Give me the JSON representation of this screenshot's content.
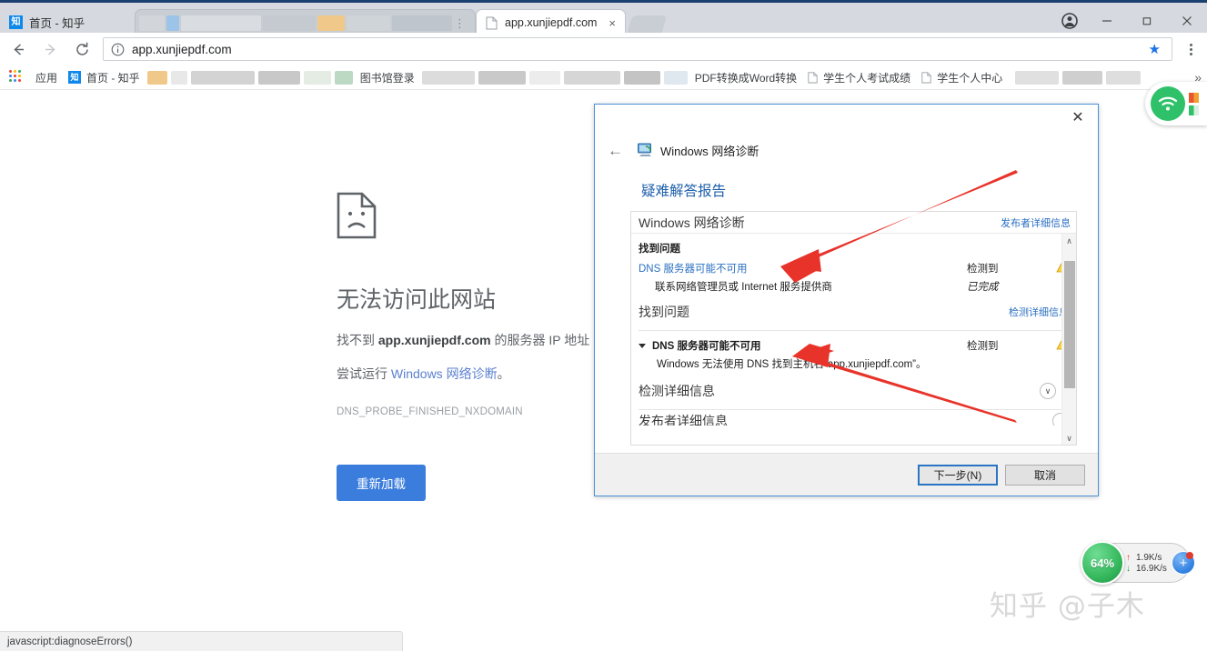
{
  "browser": {
    "tabs": [
      {
        "title": "首页 - 知乎",
        "favicon": "zhihu-icon",
        "state": "inactive"
      },
      {
        "title": "",
        "favicon": "blurred-icon",
        "state": "blurred"
      },
      {
        "title": "app.xunjiepdf.com",
        "favicon": "page-icon",
        "state": "active",
        "close_label": "×"
      }
    ],
    "window_controls": {
      "profile": "profile-icon",
      "minimize": "—",
      "maximize": "❐",
      "close": "✕"
    },
    "toolbar": {
      "back": "←",
      "forward": "→",
      "reload": "⟳",
      "url": "app.xunjiepdf.com",
      "info_icon": "info-circle-icon",
      "star": "★",
      "menu": "three-dots-icon"
    },
    "bookmarks": [
      {
        "label": "应用",
        "icon": "apps-grid-icon"
      },
      {
        "label": "首页 - 知乎",
        "icon": "zhihu-icon"
      },
      {
        "label": "",
        "icon": "blurred"
      },
      {
        "label": "图书馆登录",
        "icon": "none"
      },
      {
        "label": "",
        "icon": "blurred"
      },
      {
        "label": "PDF转换成Word转换",
        "icon": "doc-icon"
      },
      {
        "label": "学生个人考试成绩",
        "icon": "doc-icon"
      },
      {
        "label": "学生个人中心",
        "icon": "doc-icon"
      },
      {
        "label": "",
        "icon": "blurred"
      }
    ],
    "bookmarks_overflow": "»"
  },
  "error_page": {
    "icon": "sad-document-icon",
    "title": "无法访问此网站",
    "description_prefix": "找不到 ",
    "description_host": "app.xunjiepdf.com",
    "description_suffix": " 的服务器 IP 地址",
    "link_prefix": "尝试运行 ",
    "link_text": "Windows 网络诊断",
    "link_suffix": "。",
    "error_code": "DNS_PROBE_FINISHED_NXDOMAIN",
    "reload_button": "重新加载"
  },
  "dialog": {
    "close_label": "✕",
    "back_label": "←",
    "app_icon": "network-diagnostics-icon",
    "app_title": "Windows 网络诊断",
    "report_heading": "疑难解答报告",
    "panel": {
      "header_title": "Windows 网络诊断",
      "header_link": "发布者详细信息",
      "section1_title": "找到问题",
      "issue1": {
        "name": "DNS 服务器可能不可用",
        "status": "检测到",
        "warn_icon": "warning-triangle-icon",
        "sub_text": "联系网络管理员或 Internet 服务提供商",
        "sub_status": "已完成"
      },
      "section2_title": "找到问题",
      "section2_link": "检测详细信息",
      "issue2": {
        "name": "DNS 服务器可能不可用",
        "status": "检测到",
        "warn_icon": "warning-triangle-icon",
        "sub_text": "Windows 无法使用 DNS 找到主机名“app.xunjiepdf.com”。"
      },
      "detail_row": "检测详细信息",
      "clipped_row": "发布者详细信息",
      "scroll_up": "∧",
      "scroll_down": "∨",
      "chevron": "∨"
    },
    "buttons": {
      "next": "下一步(N)",
      "next_mnemonic": "N",
      "cancel": "取消"
    }
  },
  "widgets": {
    "wifi": {
      "icon": "wifi-icon",
      "color": "#2fc16a"
    },
    "speed": {
      "percent": "64%",
      "upload": "1.9K/s",
      "download": "16.9K/s",
      "up_arrow": "↑",
      "down_arrow": "↓",
      "add_label": "+"
    },
    "watermark": "知乎 @子木"
  },
  "status_bar": {
    "text": "javascript:diagnoseErrors()"
  },
  "colors": {
    "accent_blue": "#3b7ddd",
    "titlebar": "#1b3f6e",
    "dialog_border": "#4a90d9",
    "arrow_red": "#e8332a",
    "green": "#2fc16a"
  }
}
